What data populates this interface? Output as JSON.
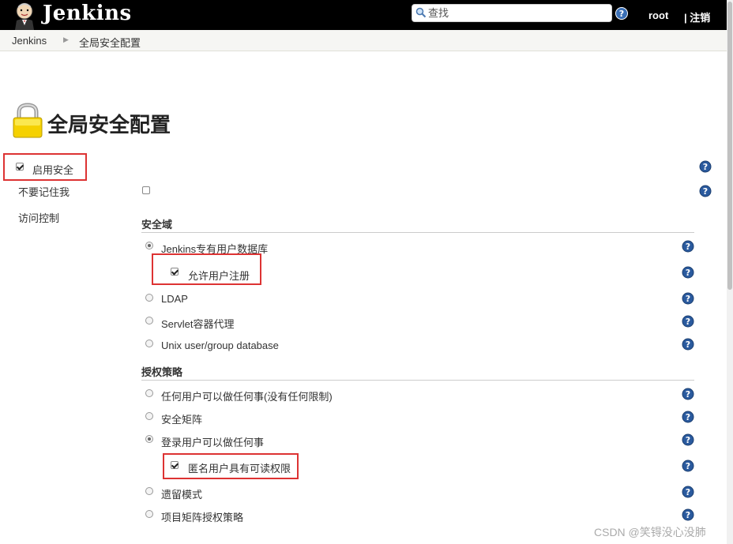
{
  "header": {
    "brand": "Jenkins",
    "search_placeholder": "查找",
    "user": "root",
    "logout": "| 注销"
  },
  "breadcrumb": {
    "items": [
      "Jenkins",
      "全局安全配置"
    ]
  },
  "page": {
    "title": "全局安全配置"
  },
  "settings": {
    "enable_security": {
      "label": "启用安全",
      "checked": true
    },
    "dont_remember": {
      "label": "不要记住我",
      "checked": false
    },
    "access_control": {
      "label": "访问控制"
    }
  },
  "security_realm": {
    "heading": "安全域",
    "options": [
      {
        "label": "Jenkins专有用户数据库",
        "selected": true
      },
      {
        "label": "LDAP",
        "selected": false
      },
      {
        "label": "Servlet容器代理",
        "selected": false
      },
      {
        "label": "Unix user/group database",
        "selected": false
      }
    ],
    "allow_signup": {
      "label": "允许用户注册",
      "checked": true
    }
  },
  "authorization": {
    "heading": "授权策略",
    "options": [
      {
        "label": "任何用户可以做任何事(没有任何限制)",
        "selected": false
      },
      {
        "label": "安全矩阵",
        "selected": false
      },
      {
        "label": "登录用户可以做任何事",
        "selected": true
      },
      {
        "label": "遗留模式",
        "selected": false
      },
      {
        "label": "项目矩阵授权策略",
        "selected": false
      }
    ],
    "anonymous_read": {
      "label": "匿名用户具有可读权限",
      "checked": true
    }
  },
  "watermark": "CSDN @笑锝没心没肺",
  "colors": {
    "topbar": "#000000",
    "highlight": "#dd3333",
    "help_icon": "#2a5a9e"
  }
}
